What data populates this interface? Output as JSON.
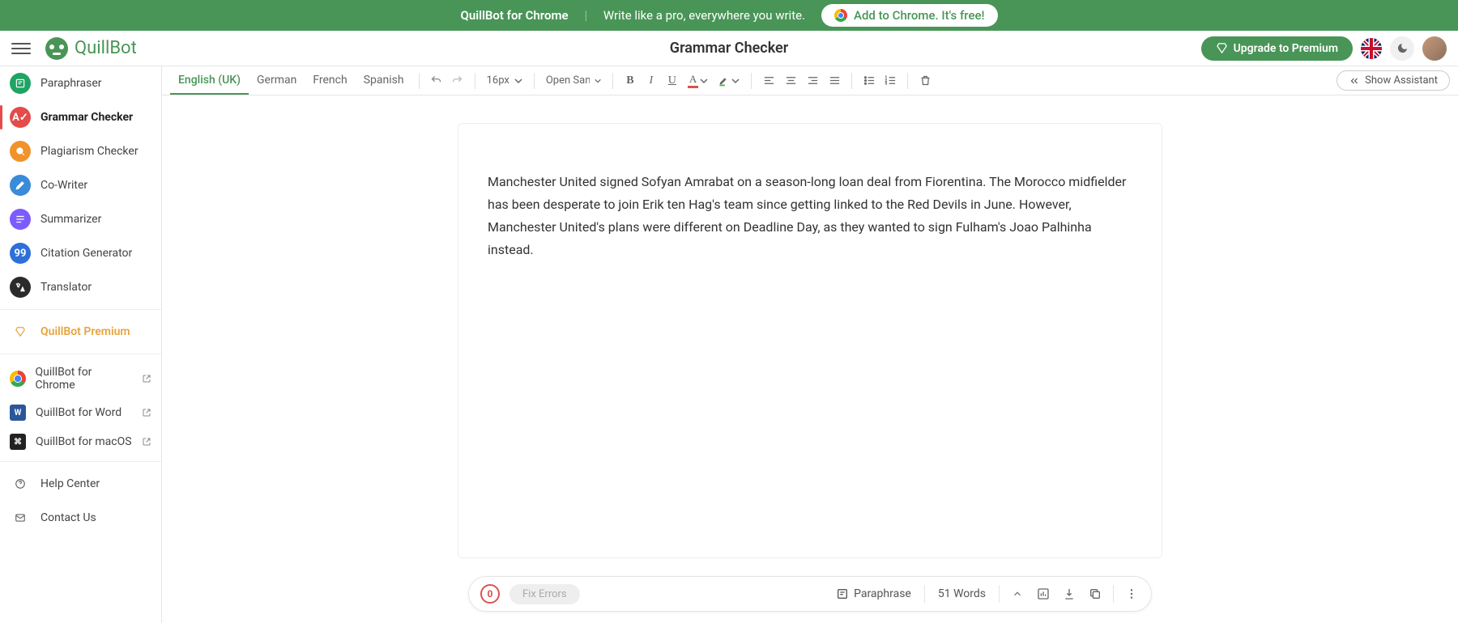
{
  "banner": {
    "product": "QuillBot for Chrome",
    "tagline": "Write like a pro, everywhere you write.",
    "cta": "Add to Chrome. It's free!"
  },
  "header": {
    "brand": "QuillBot",
    "page_title": "Grammar Checker",
    "upgrade": "Upgrade to Premium"
  },
  "sidebar": {
    "items": [
      {
        "label": "Paraphraser",
        "color": "#1fa463",
        "icon": "paraphrase-icon"
      },
      {
        "label": "Grammar Checker",
        "color": "#e54b4b",
        "icon": "grammar-icon",
        "active": true
      },
      {
        "label": "Plagiarism Checker",
        "color": "#f0932b",
        "icon": "plagiarism-icon"
      },
      {
        "label": "Co-Writer",
        "color": "#3a8bd8",
        "icon": "cowriter-icon"
      },
      {
        "label": "Summarizer",
        "color": "#7b5cff",
        "icon": "summarizer-icon"
      },
      {
        "label": "Citation Generator",
        "color": "#2e6fd9",
        "icon": "citation-icon"
      },
      {
        "label": "Translator",
        "color": "#2b2b2b",
        "icon": "translate-icon"
      }
    ],
    "premium": {
      "label": "QuillBot Premium"
    },
    "extensions": [
      {
        "label": "QuillBot for Chrome",
        "kind": "chrome"
      },
      {
        "label": "QuillBot for Word",
        "kind": "word"
      },
      {
        "label": "QuillBot for macOS",
        "kind": "macos"
      }
    ],
    "help": {
      "label": "Help Center"
    },
    "contact": {
      "label": "Contact Us"
    }
  },
  "toolbar": {
    "languages": [
      "English (UK)",
      "German",
      "French",
      "Spanish"
    ],
    "active_lang_index": 0,
    "font_size": "16px",
    "font_family": "Open San...",
    "show_assistant": "Show Assistant"
  },
  "editor": {
    "text": "Manchester United signed Sofyan Amrabat on a season-long loan deal from Fiorentina. The Morocco midfielder has been desperate to join Erik ten Hag's team since getting linked to the Red Devils in June. However, Manchester United's plans were different on Deadline Day, as they wanted to sign Fulham's Joao Palhinha instead."
  },
  "bottom": {
    "errors": "0",
    "fix_label": "Fix Errors",
    "paraphrase": "Paraphrase",
    "wordcount": "51 Words"
  },
  "tiny": "tiny"
}
